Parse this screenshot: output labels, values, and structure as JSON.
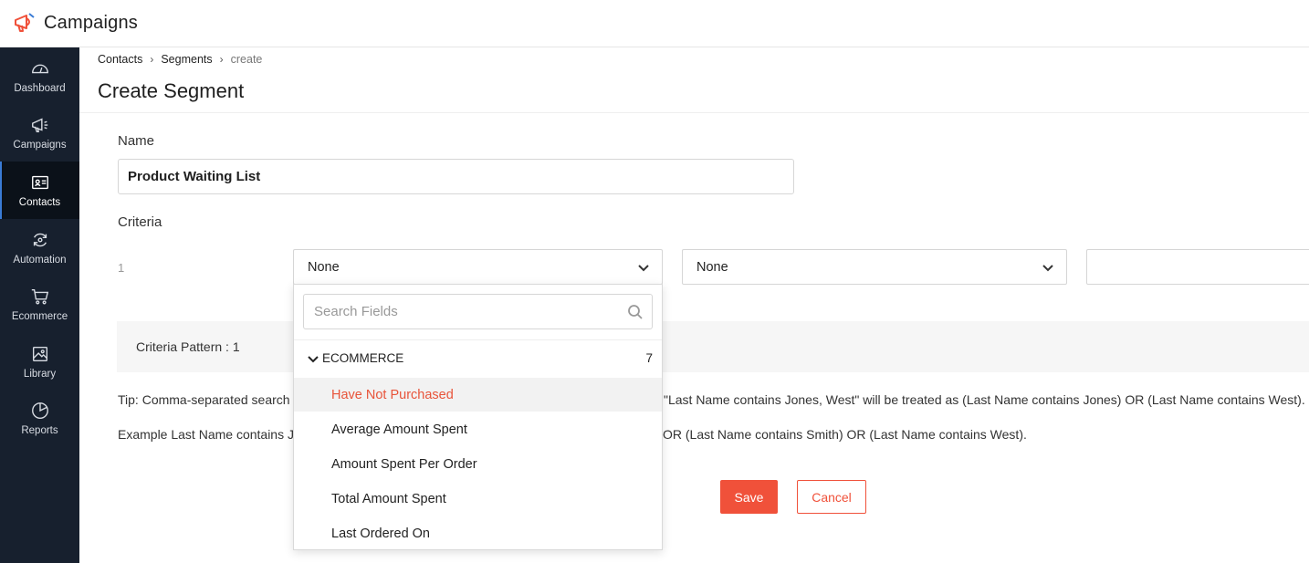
{
  "app": {
    "title": "Campaigns",
    "accent": "#f0513a",
    "sidebar_bg": "#17202e"
  },
  "sidebar": {
    "items": [
      {
        "label": "Dashboard",
        "icon": "dashboard-gauge-icon"
      },
      {
        "label": "Campaigns",
        "icon": "megaphone-icon"
      },
      {
        "label": "Contacts",
        "icon": "contact-card-icon",
        "active": true
      },
      {
        "label": "Automation",
        "icon": "automation-cycle-icon"
      },
      {
        "label": "Ecommerce",
        "icon": "shopping-cart-icon"
      },
      {
        "label": "Library",
        "icon": "image-library-icon"
      },
      {
        "label": "Reports",
        "icon": "pie-chart-icon"
      }
    ]
  },
  "breadcrumb": {
    "items": [
      "Contacts",
      "Segments"
    ],
    "current": "create"
  },
  "page": {
    "title": "Create Segment"
  },
  "form": {
    "name_label": "Name",
    "name_value": "Product Waiting List",
    "criteria_label": "Criteria",
    "criteria_row_number": "1",
    "field_select": "None",
    "operator_select": "None",
    "value_input": "",
    "pattern_label": "Criteria Pattern : 1",
    "tip_part1": "Tip: Comma-separated search",
    "tip_part2": "\"Last Name contains Jones, West\" will be treated as (Last Name contains Jones) OR (Last Name contains West).",
    "example_part1": "Example  Last Name contains J",
    "example_part2": "OR (Last Name contains Smith) OR (Last Name contains West).",
    "save_label": "Save",
    "cancel_label": "Cancel"
  },
  "dropdown": {
    "search_placeholder": "Search Fields",
    "group_name": "ECOMMERCE",
    "group_count": "7",
    "items": [
      {
        "label": "Have Not Purchased",
        "highlighted": true
      },
      {
        "label": "Average Amount Spent"
      },
      {
        "label": "Amount Spent Per Order"
      },
      {
        "label": "Total Amount Spent"
      },
      {
        "label": "Last Ordered On"
      }
    ]
  }
}
